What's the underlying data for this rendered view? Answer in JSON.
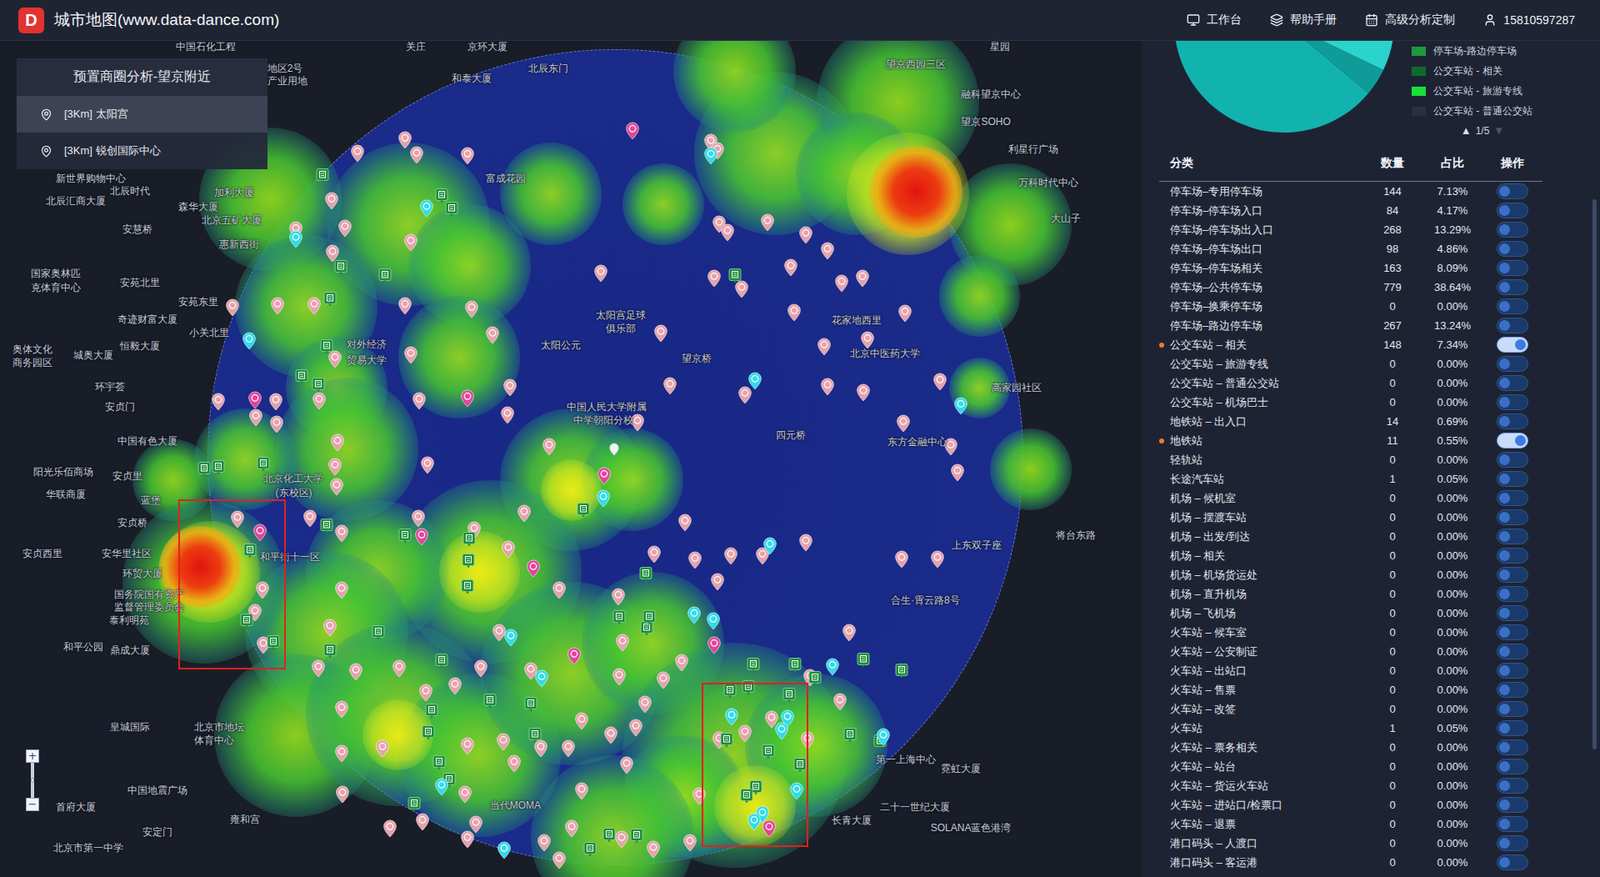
{
  "topbar": {
    "logo": "D",
    "title": "城市地图(www.data-dance.com)",
    "nav": [
      {
        "label": "工作台"
      },
      {
        "label": "帮助手册"
      },
      {
        "label": "高级分析定制"
      },
      {
        "label": "15810597287"
      }
    ]
  },
  "map": {
    "preset_panel": {
      "title": "预置商圈分析-望京附近",
      "items": [
        {
          "label": "[3Km] 太阳宫",
          "selected": true
        },
        {
          "label": "[3Km] 锐创国际中心",
          "selected": false
        }
      ]
    },
    "zoom": {
      "in": "+",
      "out": "−"
    },
    "labels": [
      "中国石化工程",
      "地区2号",
      "产业用地",
      "关庄",
      "京环大厦",
      "和泰大厦",
      "北辰东门",
      "星园",
      "望京西园三区",
      "融科望京中心",
      "望京SOHO",
      "利星行广场",
      "万科时代中心",
      "大山子",
      "新世界购物中心",
      "北辰时代",
      "北辰汇商大厦",
      "加利大厦",
      "森华大厦",
      "北京五矿大厦",
      "安慧桥",
      "惠新西街",
      "富成花园",
      "国家奥林匹",
      "克体育中心",
      "安苑北里",
      "安苑东里",
      "奇迹财富大厦",
      "小关北里",
      "恒毅大厦",
      "城奥大厦",
      "奥体文化",
      "商务园区",
      "对外经济",
      "贸易大学",
      "太阳宫足球",
      "俱乐部",
      "太阳公元",
      "花家地西里",
      "北京中医药大学",
      "望京桥",
      "高家园社区",
      "环宇荟",
      "安贞门",
      "中国人民大学附属",
      "中学朝阳分校",
      "四元桥",
      "中国有色大厦",
      "东方金融中心",
      "阳光乐佰商场",
      "安贞里",
      "北京化工大学",
      "(东校区)",
      "华联商厦",
      "蓝堡",
      "安贞桥",
      "将台东路",
      "上东双子座",
      "安贞西里",
      "安华里社区",
      "和平街十一区",
      "环贸大厦",
      "国务院国有资产",
      "合生·霄云路8号",
      "监督管理委员会",
      "泰利明苑",
      "和平公园",
      "鼎成大厦",
      "皇城国际",
      "北京市地坛",
      "体育中心",
      "第一上海中心",
      "霓虹大厦",
      "中国地震广场",
      "当代MOMA",
      "二十一世纪大厦",
      "首府大厦",
      "长青大厦",
      "SOLANA蓝色港湾",
      "雍和宫",
      "安定门",
      "北京市第一中学"
    ]
  },
  "pie": {
    "slices": [
      {
        "value": 88,
        "color": "#12b3ae"
      },
      {
        "value": 8,
        "color": "#2ad3cb"
      },
      {
        "value": 4,
        "color": "#0f9c98"
      }
    ]
  },
  "legend": {
    "items": [
      {
        "label": "停车场-路边停车场",
        "color": "#1c9a3c"
      },
      {
        "label": "公交车站 - 相关",
        "color": "#0f6b2b"
      },
      {
        "label": "公交车站 - 旅游专线",
        "color": "#19e03a"
      },
      {
        "label": "公交车站 - 普通公交站",
        "color": "#2a303c"
      }
    ],
    "pager": {
      "prev": "▲",
      "page": "1/5",
      "next": "▼",
      "prev_disabled": false,
      "next_disabled": true
    }
  },
  "table": {
    "columns": [
      "分类",
      "数量",
      "占比",
      "操作"
    ],
    "rows": [
      {
        "category": "停车场–专用停车场",
        "count": "144",
        "share": "7.13%",
        "on": false
      },
      {
        "category": "停车场–停车场入口",
        "count": "84",
        "share": "4.17%",
        "on": false
      },
      {
        "category": "停车场–停车场出入口",
        "count": "268",
        "share": "13.29%",
        "on": false
      },
      {
        "category": "停车场–停车场出口",
        "count": "98",
        "share": "4.86%",
        "on": false
      },
      {
        "category": "停车场–停车场相关",
        "count": "163",
        "share": "8.09%",
        "on": false
      },
      {
        "category": "停车场–公共停车场",
        "count": "779",
        "share": "38.64%",
        "on": false
      },
      {
        "category": "停车场–换乘停车场",
        "count": "0",
        "share": "0.00%",
        "on": false
      },
      {
        "category": "停车场–路边停车场",
        "count": "267",
        "share": "13.24%",
        "on": false
      },
      {
        "category": "公交车站 – 相关",
        "count": "148",
        "share": "7.34%",
        "on": true
      },
      {
        "category": "公交车站 – 旅游专线",
        "count": "0",
        "share": "0.00%",
        "on": false
      },
      {
        "category": "公交车站 – 普通公交站",
        "count": "0",
        "share": "0.00%",
        "on": false
      },
      {
        "category": "公交车站 – 机场巴士",
        "count": "0",
        "share": "0.00%",
        "on": false
      },
      {
        "category": "地铁站 – 出入口",
        "count": "14",
        "share": "0.69%",
        "on": false
      },
      {
        "category": "地铁站",
        "count": "11",
        "share": "0.55%",
        "on": true
      },
      {
        "category": "轻轨站",
        "count": "0",
        "share": "0.00%",
        "on": false
      },
      {
        "category": "长途汽车站",
        "count": "1",
        "share": "0.05%",
        "on": false
      },
      {
        "category": "机场 – 候机室",
        "count": "0",
        "share": "0.00%",
        "on": false
      },
      {
        "category": "机场 – 摆渡车站",
        "count": "0",
        "share": "0.00%",
        "on": false
      },
      {
        "category": "机场 – 出发/到达",
        "count": "0",
        "share": "0.00%",
        "on": false
      },
      {
        "category": "机场 – 相关",
        "count": "0",
        "share": "0.00%",
        "on": false
      },
      {
        "category": "机场 – 机场货运处",
        "count": "0",
        "share": "0.00%",
        "on": false
      },
      {
        "category": "机场 – 直升机场",
        "count": "0",
        "share": "0.00%",
        "on": false
      },
      {
        "category": "机场 – 飞机场",
        "count": "0",
        "share": "0.00%",
        "on": false
      },
      {
        "category": "火车站 – 候车室",
        "count": "0",
        "share": "0.00%",
        "on": false
      },
      {
        "category": "火车站 – 公安制证",
        "count": "0",
        "share": "0.00%",
        "on": false
      },
      {
        "category": "火车站 – 出站口",
        "count": "0",
        "share": "0.00%",
        "on": false
      },
      {
        "category": "火车站 – 售票",
        "count": "0",
        "share": "0.00%",
        "on": false
      },
      {
        "category": "火车站 – 改签",
        "count": "0",
        "share": "0.00%",
        "on": false
      },
      {
        "category": "火车站",
        "count": "1",
        "share": "0.05%",
        "on": false
      },
      {
        "category": "火车站 – 票务相关",
        "count": "0",
        "share": "0.00%",
        "on": false
      },
      {
        "category": "火车站 – 站台",
        "count": "0",
        "share": "0.00%",
        "on": false
      },
      {
        "category": "火车站 – 货运火车站",
        "count": "0",
        "share": "0.00%",
        "on": false
      },
      {
        "category": "火车站 – 进站口/检票口",
        "count": "0",
        "share": "0.00%",
        "on": false
      },
      {
        "category": "火车站 – 退票",
        "count": "0",
        "share": "0.00%",
        "on": false
      },
      {
        "category": "港口码头 – 人渡口",
        "count": "0",
        "share": "0.00%",
        "on": false
      },
      {
        "category": "港口码头 – 客运港",
        "count": "0",
        "share": "0.00%",
        "on": false
      }
    ]
  }
}
